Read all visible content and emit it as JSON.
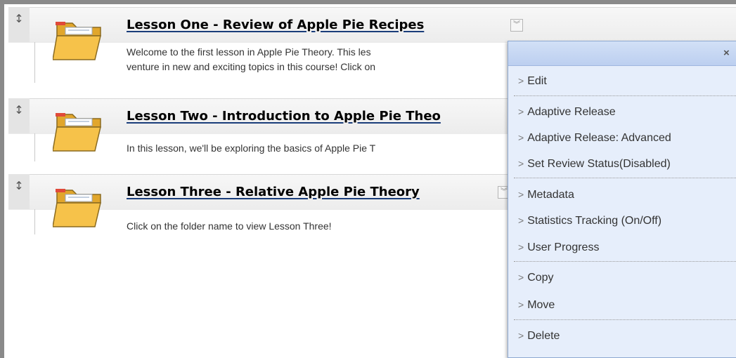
{
  "lessons": [
    {
      "title": "Lesson One - Review of Apple Pie Recipes",
      "desc_line1": "Welcome to the first lesson in Apple Pie Theory.  This les",
      "desc_line2": "venture in new and exciting topics in this course!  Click on"
    },
    {
      "title": "Lesson Two - Introduction to Apple Pie Theo",
      "desc_line1": "In this lesson, we'll be exploring the basics of Apple Pie T"
    },
    {
      "title": "Lesson Three - Relative Apple Pie Theory",
      "desc_line1": "Click on the folder name to view Lesson Three!"
    }
  ],
  "icons": {
    "grip": "drag-handle-icon",
    "folder": "folder-icon",
    "chevron": "chevron-down-icon",
    "close": "close-icon"
  },
  "menu": {
    "close_label": "×",
    "items": [
      "Edit",
      "Adaptive Release",
      "Adaptive Release: Advanced",
      "Set Review Status(Disabled)",
      "Metadata",
      "Statistics Tracking (On/Off)",
      "User Progress",
      "Copy",
      "Move",
      "Delete"
    ]
  },
  "colors": {
    "menu_bg": "#e6eefb",
    "menu_header": "#c6d6f3",
    "title_underline": "#1a3d7a",
    "folder_fill": "#f6c24a"
  }
}
